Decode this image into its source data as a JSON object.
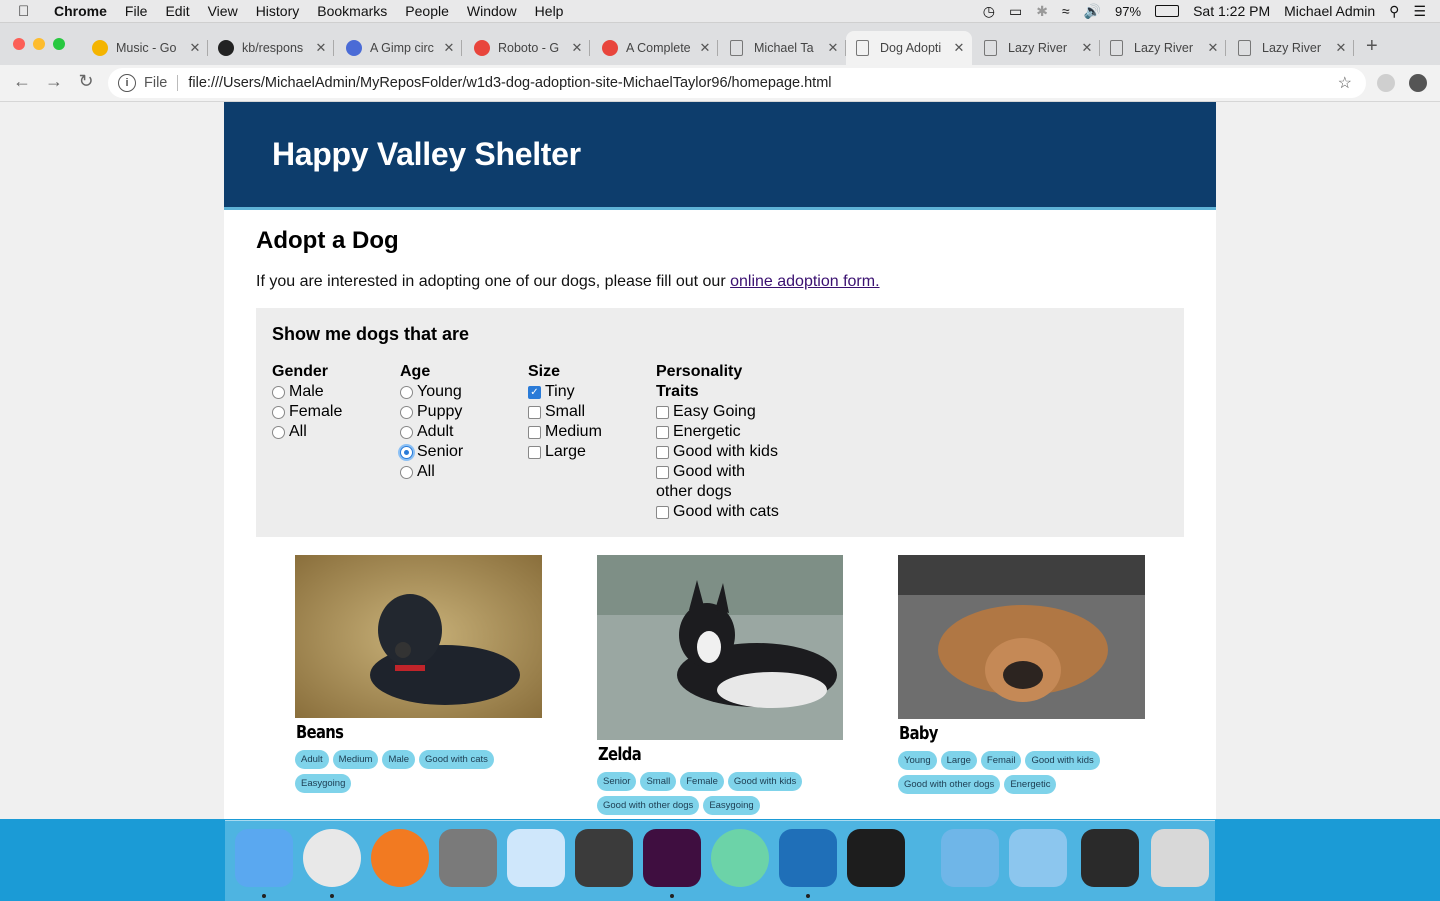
{
  "menubar": {
    "app": "Chrome",
    "items": [
      "File",
      "Edit",
      "View",
      "History",
      "Bookmarks",
      "People",
      "Window",
      "Help"
    ],
    "battery": "97%",
    "clock": "Sat 1:22 PM",
    "user": "Michael Admin"
  },
  "tabs": [
    {
      "title": "Music - Go",
      "icon": "google-drive-icon",
      "color": "#f4b400"
    },
    {
      "title": "kb/respons",
      "icon": "github-icon",
      "color": "#222222"
    },
    {
      "title": "A Gimp circ",
      "icon": "letter-a-icon",
      "color": "#4a6bd6"
    },
    {
      "title": "Roboto - G",
      "icon": "fonts-icon",
      "color": "#e8453c"
    },
    {
      "title": "A Complete",
      "icon": "css-tricks-icon",
      "color": "#e8453c"
    },
    {
      "title": "Michael Ta",
      "icon": "document-icon",
      "color": "#888888"
    },
    {
      "title": "Dog Adopti",
      "icon": "document-icon",
      "color": "#888888"
    },
    {
      "title": "Lazy River",
      "icon": "document-icon",
      "color": "#888888"
    },
    {
      "title": "Lazy River",
      "icon": "document-icon",
      "color": "#888888"
    },
    {
      "title": "Lazy River",
      "icon": "document-icon",
      "color": "#888888"
    }
  ],
  "omnibox": {
    "scheme": "File",
    "url": "file:///Users/MichaelAdmin/MyReposFolder/w1d3-dog-adoption-site-MichaelTaylor96/homepage.html"
  },
  "site": {
    "title": "Happy Valley Shelter",
    "header_color": "#0d3d6c",
    "section_title": "Adopt a Dog",
    "intro_text": "If you are interested in adopting one of our dogs, please fill out our ",
    "intro_link": "online adoption form."
  },
  "filters": {
    "title": "Show me dogs that are",
    "gender": {
      "heading": "Gender",
      "options": [
        "Male",
        "Female",
        "All"
      ]
    },
    "age": {
      "heading": "Age",
      "options": [
        "Young",
        "Puppy",
        "Adult",
        "Senior",
        "All"
      ],
      "selected": "Senior"
    },
    "size": {
      "heading": "Size",
      "options": [
        "Tiny",
        "Small",
        "Medium",
        "Large"
      ],
      "checked": [
        "Tiny"
      ]
    },
    "traits": {
      "heading_1": "Personality",
      "heading_2": "Traits",
      "options": [
        "Easy Going",
        "Energetic",
        "Good with kids",
        "Good with",
        "Good with cats"
      ],
      "option_4_line2": "other dogs"
    }
  },
  "dogs": [
    {
      "name": "Beans",
      "tags": [
        "Adult",
        "Medium",
        "Male",
        "Good with cats",
        "Easygoing"
      ]
    },
    {
      "name": "Zelda",
      "tags": [
        "Senior",
        "Small",
        "Female",
        "Good with kids",
        "Good with other dogs",
        "Easygoing"
      ]
    },
    {
      "name": "Baby",
      "tags": [
        "Young",
        "Large",
        "Femail",
        "Good with kids",
        "Good with other dogs",
        "Energetic"
      ]
    }
  ],
  "dock": [
    "finder-icon",
    "chrome-icon",
    "firefox-icon",
    "system-preferences-icon",
    "balsamiq-icon",
    "sketch-icon",
    "slack-icon",
    "atom-icon",
    "vscode-icon",
    "terminal-icon",
    "applications-folder-icon",
    "documents-folder-icon",
    "google-plus-icon",
    "trash-icon"
  ]
}
